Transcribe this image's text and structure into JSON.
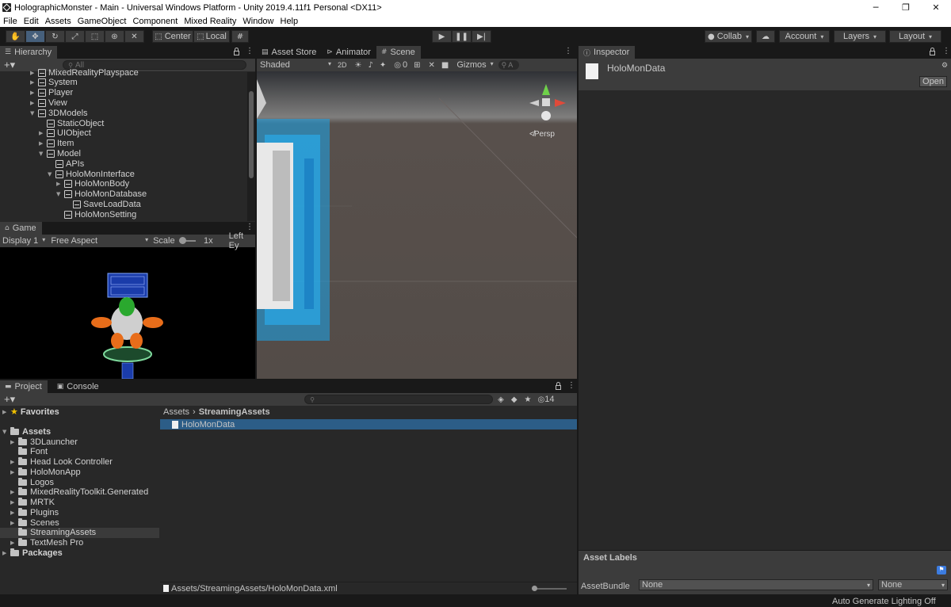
{
  "window": {
    "title": "HolographicMonster - Main - Universal Windows Platform - Unity 2019.4.11f1 Personal <DX11>",
    "minimize": "─",
    "maximize": "❐",
    "close": "✕"
  },
  "menu": [
    "File",
    "Edit",
    "Assets",
    "GameObject",
    "Component",
    "Mixed Reality",
    "Window",
    "Help"
  ],
  "toolbar": {
    "center_label": "Center",
    "local_label": "Local",
    "collab_label": "Collab",
    "account_label": "Account",
    "layers_label": "Layers",
    "layout_label": "Layout"
  },
  "hierarchy": {
    "tab": "Hierarchy",
    "search_placeholder": "All",
    "items": [
      {
        "label": "MixedRealityPlayspace",
        "depth": 0,
        "arrow": "▶"
      },
      {
        "label": "System",
        "depth": 0,
        "arrow": "▶"
      },
      {
        "label": "Player",
        "depth": 0,
        "arrow": "▶"
      },
      {
        "label": "View",
        "depth": 0,
        "arrow": "▶"
      },
      {
        "label": "3DModels",
        "depth": 0,
        "arrow": "▼"
      },
      {
        "label": "StaticObject",
        "depth": 1,
        "arrow": ""
      },
      {
        "label": "UIObject",
        "depth": 1,
        "arrow": "▶"
      },
      {
        "label": "Item",
        "depth": 1,
        "arrow": "▶"
      },
      {
        "label": "Model",
        "depth": 1,
        "arrow": "▼"
      },
      {
        "label": "APIs",
        "depth": 2,
        "arrow": ""
      },
      {
        "label": "HoloMonInterface",
        "depth": 2,
        "arrow": "▼"
      },
      {
        "label": "HoloMonBody",
        "depth": 3,
        "arrow": "▶"
      },
      {
        "label": "HoloMonDatabase",
        "depth": 3,
        "arrow": "▼"
      },
      {
        "label": "SaveLoadData",
        "depth": 4,
        "arrow": ""
      },
      {
        "label": "HoloMonSetting",
        "depth": 3,
        "arrow": ""
      }
    ]
  },
  "game": {
    "tab": "Game",
    "display": "Display 1",
    "aspect": "Free Aspect",
    "scale_label": "Scale",
    "scale_value": "1x",
    "eye": "Left Ey"
  },
  "scene": {
    "tabs": [
      "Asset Store",
      "Animator",
      "Scene"
    ],
    "shading": "Shaded",
    "mode_2d": "2D",
    "hidden_count": "0",
    "gizmos": "Gizmos",
    "search_prefix": "A",
    "persp": "Persp"
  },
  "inspector": {
    "tab": "Inspector",
    "asset_name": "HoloMonData",
    "open_button": "Open",
    "asset_labels": "Asset Labels",
    "assetbundle_label": "AssetBundle",
    "assetbundle_value": "None",
    "variant_value": "None"
  },
  "project": {
    "tabs": [
      "Project",
      "Console"
    ],
    "favorites": "Favorites",
    "assets": "Assets",
    "packages": "Packages",
    "folders": [
      "3DLauncher",
      "Font",
      "Head Look Controller",
      "HoloMonApp",
      "Logos",
      "MixedRealityToolkit.Generated",
      "MRTK",
      "Plugins",
      "Scenes",
      "StreamingAssets",
      "TextMesh Pro"
    ],
    "folder_arrows": [
      "▶",
      "",
      "▶",
      "▶",
      "",
      "▶",
      "▶",
      "▶",
      "▶",
      "",
      "▶"
    ],
    "breadcrumb_root": "Assets",
    "breadcrumb_sep": "›",
    "breadcrumb_current": "StreamingAssets",
    "files": [
      "HoloMonData"
    ],
    "hidden_count": "14",
    "footer_path": "Assets/StreamingAssets/HoloMonData.xml"
  },
  "status": {
    "text": "Auto Generate Lighting Off"
  }
}
